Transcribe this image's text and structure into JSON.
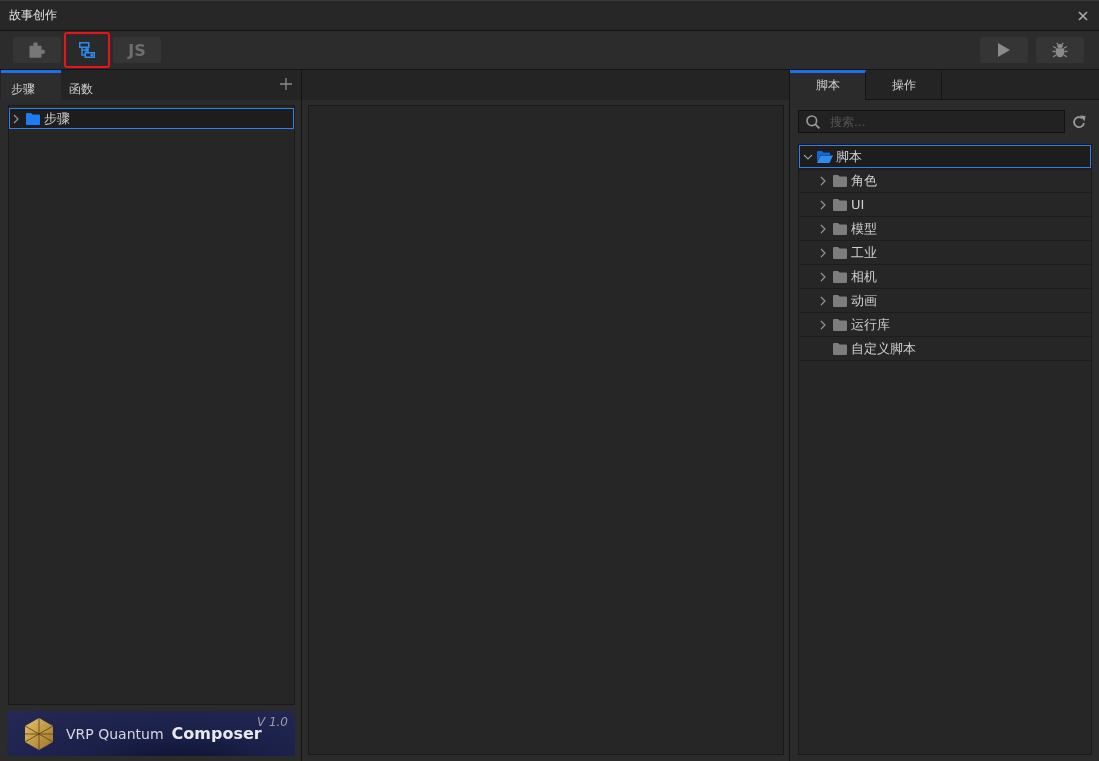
{
  "window": {
    "title": "故事创作"
  },
  "toolbar": {
    "tools": [
      {
        "kind": "plugin",
        "selected": false
      },
      {
        "kind": "flow",
        "selected": true
      },
      {
        "kind": "js",
        "label": "JS",
        "selected": false
      }
    ],
    "actions": [
      {
        "kind": "run"
      },
      {
        "kind": "debug"
      }
    ]
  },
  "left_panel": {
    "tabs": [
      {
        "label": "步骤",
        "selected": true
      },
      {
        "label": "函数",
        "selected": false
      }
    ],
    "tree": [
      {
        "label": "步骤",
        "expandable": true,
        "expanded": false,
        "selected": true
      }
    ],
    "banner": {
      "product": "VRP Quantum",
      "name": "Composer",
      "version": "V 1.0"
    }
  },
  "right_panel": {
    "tabs": [
      {
        "label": "脚本",
        "selected": true
      },
      {
        "label": "操作",
        "selected": false
      }
    ],
    "search": {
      "placeholder": "搜索..."
    },
    "tree": [
      {
        "label": "脚本",
        "expandable": true,
        "expanded": true,
        "selected": true,
        "children": [
          {
            "label": "角色",
            "expandable": true,
            "expanded": false,
            "selected": false
          },
          {
            "label": "UI",
            "expandable": true,
            "expanded": false,
            "selected": false
          },
          {
            "label": "模型",
            "expandable": true,
            "expanded": false,
            "selected": false
          },
          {
            "label": "工业",
            "expandable": true,
            "expanded": false,
            "selected": false
          },
          {
            "label": "相机",
            "expandable": true,
            "expanded": false,
            "selected": false
          },
          {
            "label": "动画",
            "expandable": true,
            "expanded": false,
            "selected": false
          },
          {
            "label": "运行库",
            "expandable": true,
            "expanded": false,
            "selected": false
          },
          {
            "label": "自定义脚本",
            "expandable": false,
            "expanded": false,
            "selected": false
          }
        ]
      }
    ]
  }
}
